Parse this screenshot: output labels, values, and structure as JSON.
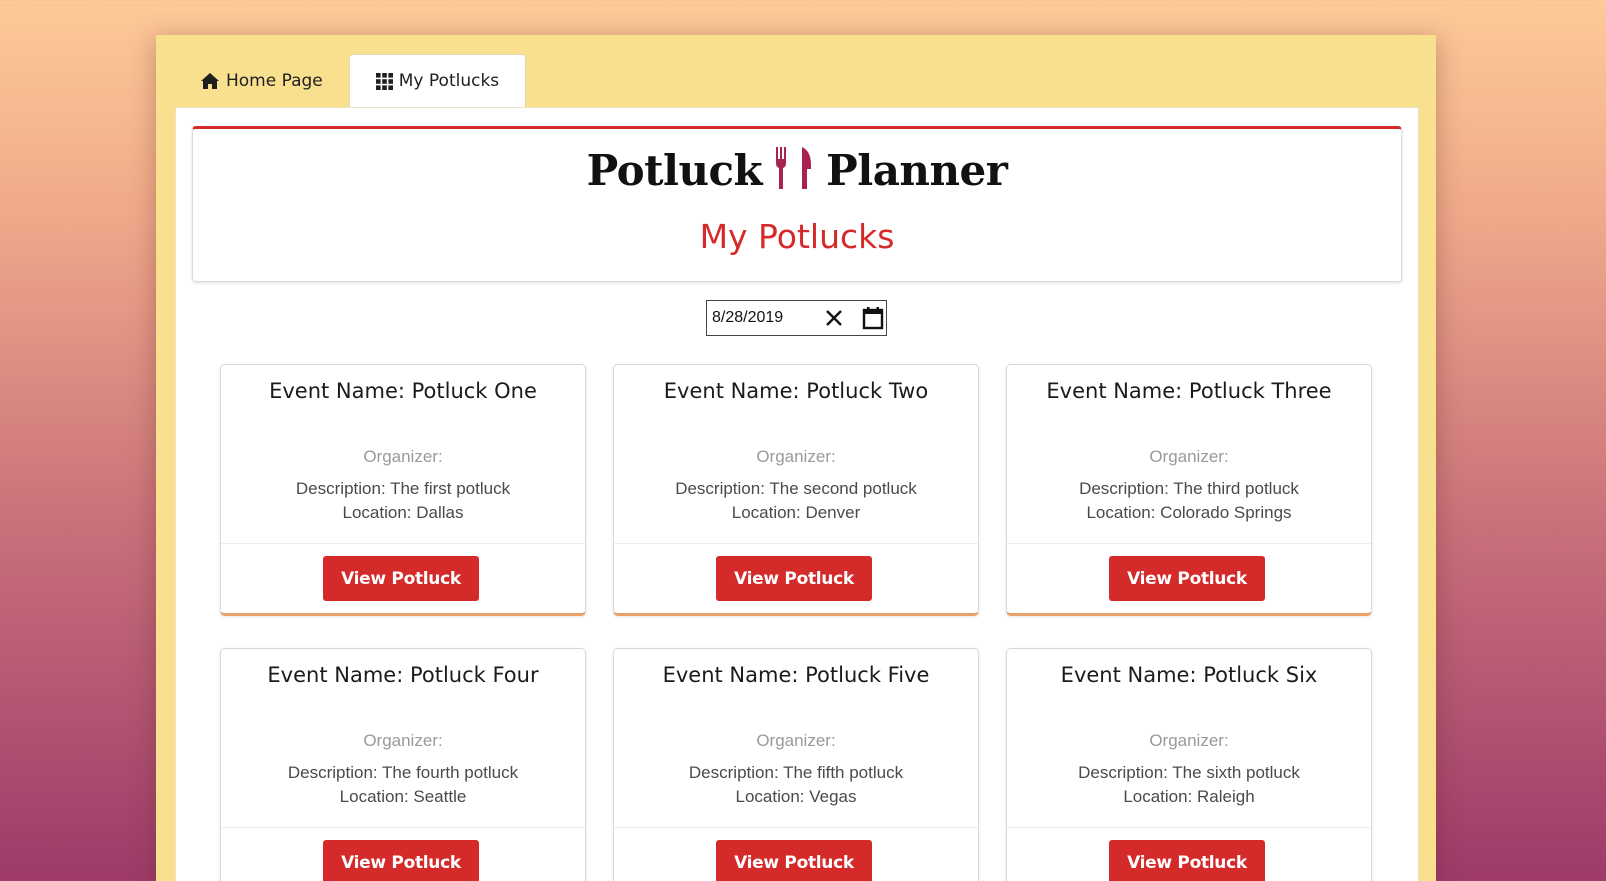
{
  "tabs": [
    {
      "label": "Home Page",
      "icon": "home-icon"
    },
    {
      "label": "My Potlucks",
      "icon": "grid-icon"
    }
  ],
  "header": {
    "logo_left": "Potluck",
    "logo_right": "Planner",
    "logo_icon": "fork-knife-icon",
    "title": "My Potlucks"
  },
  "date_filter": {
    "value": "8/28/2019",
    "clear_icon": "close-icon",
    "calendar_icon": "calendar-icon"
  },
  "events": [
    {
      "name": "Event Name: Potluck One",
      "organizer": "Organizer:",
      "description": "Description: The first potluck",
      "location": "Location: Dallas",
      "button": "View Potluck"
    },
    {
      "name": "Event Name: Potluck Two",
      "organizer": "Organizer:",
      "description": "Description: The second potluck",
      "location": "Location: Denver",
      "button": "View Potluck"
    },
    {
      "name": "Event Name: Potluck Three",
      "organizer": "Organizer:",
      "description": "Description: The third potluck",
      "location": "Location: Colorado Springs",
      "button": "View Potluck"
    },
    {
      "name": "Event Name: Potluck Four",
      "organizer": "Organizer:",
      "description": "Description: The fourth potluck",
      "location": "Location: Seattle",
      "button": "View Potluck"
    },
    {
      "name": "Event Name: Potluck Five",
      "organizer": "Organizer:",
      "description": "Description: The fifth potluck",
      "location": "Location: Vegas",
      "button": "View Potluck"
    },
    {
      "name": "Event Name: Potluck Six",
      "organizer": "Organizer:",
      "description": "Description: The sixth potluck",
      "location": "Location: Raleigh",
      "button": "View Potluck"
    }
  ],
  "colors": {
    "accent": "#d42a2a",
    "logo_icon": "#a8234f",
    "panel": "#f9e08f",
    "card_bottom_border": "#e9a16a"
  }
}
